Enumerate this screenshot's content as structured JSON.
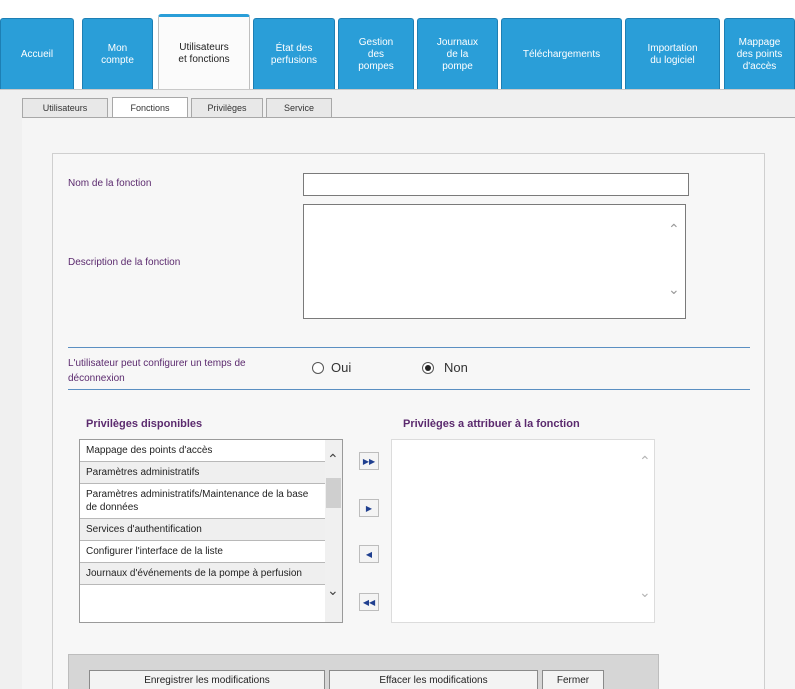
{
  "top_tabs": [
    {
      "label": "Accueil"
    },
    {
      "label": "Mon\ncompte"
    },
    {
      "label": "Utilisateurs\net fonctions"
    },
    {
      "label": "État des\nperfusions"
    },
    {
      "label": "Gestion\ndes\npompes"
    },
    {
      "label": "Journaux\nde la\npompe"
    },
    {
      "label": "Téléchargements"
    },
    {
      "label": "Importation\ndu logiciel"
    },
    {
      "label": "Mappage\ndes points\nd'accès"
    }
  ],
  "sub_tabs": [
    {
      "label": "Utilisateurs"
    },
    {
      "label": "Fonctions"
    },
    {
      "label": "Privilèges"
    },
    {
      "label": "Service"
    }
  ],
  "form": {
    "name_label": "Nom de la fonction",
    "name_value": "",
    "description_label": "Description de la fonction",
    "description_value": "",
    "logout_label": "L'utilisateur peut configurer un temps de déconnexion",
    "option_yes": "Oui",
    "option_no": "Non",
    "logout_selected": "Non"
  },
  "privileges": {
    "available_title": "Privilèges disponibles",
    "assigned_title": "Privilèges a attribuer à la fonction",
    "available_items": [
      "Mappage des points d'accès",
      "Paramètres administratifs",
      "Paramètres administratifs/Maintenance de la base de données",
      "Services d'authentification",
      "Configurer l'interface de la liste",
      "Journaux d'événements de la pompe à perfusion"
    ],
    "assigned_items": []
  },
  "buttons": {
    "save": "Enregistrer les modifications",
    "clear": "Effacer les modifications",
    "close": "Fermer"
  },
  "colors": {
    "tab_blue": "#2a9ed8",
    "label_purple": "#5b2a6e",
    "divider_blue": "#5b8fc2"
  }
}
